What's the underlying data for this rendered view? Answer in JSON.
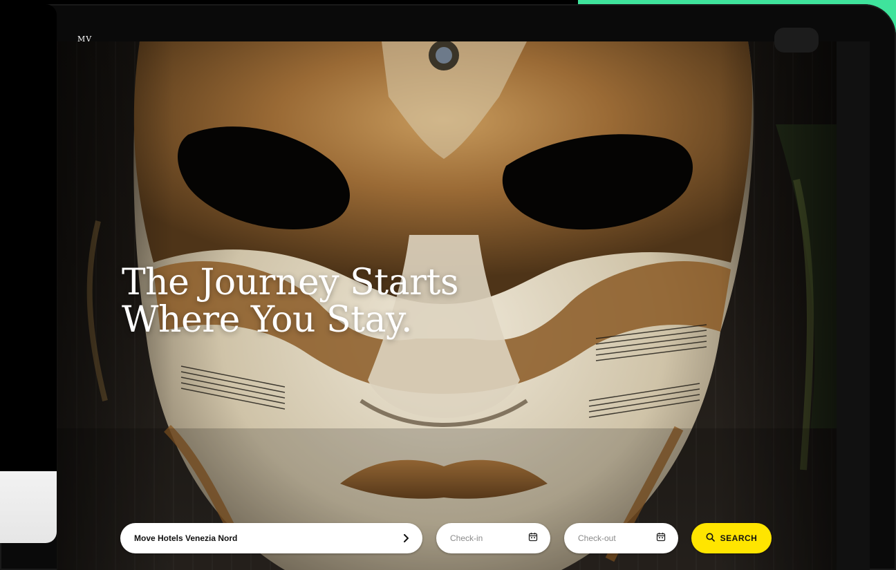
{
  "brand": {
    "logo_text": "MV"
  },
  "hero": {
    "title_line1": "The Journey Starts",
    "title_line2": "Where You Stay."
  },
  "booking": {
    "hotel_value": "Move Hotels Venezia Nord",
    "checkin_placeholder": "Check-in",
    "checkout_placeholder": "Check-out",
    "search_label": "SEARCH"
  },
  "colors": {
    "accent_green": "#3fe39c",
    "search_yellow": "#ffe500"
  },
  "icons": {
    "chevron": "chevron-right-icon",
    "calendar": "calendar-icon",
    "search": "search-icon"
  }
}
